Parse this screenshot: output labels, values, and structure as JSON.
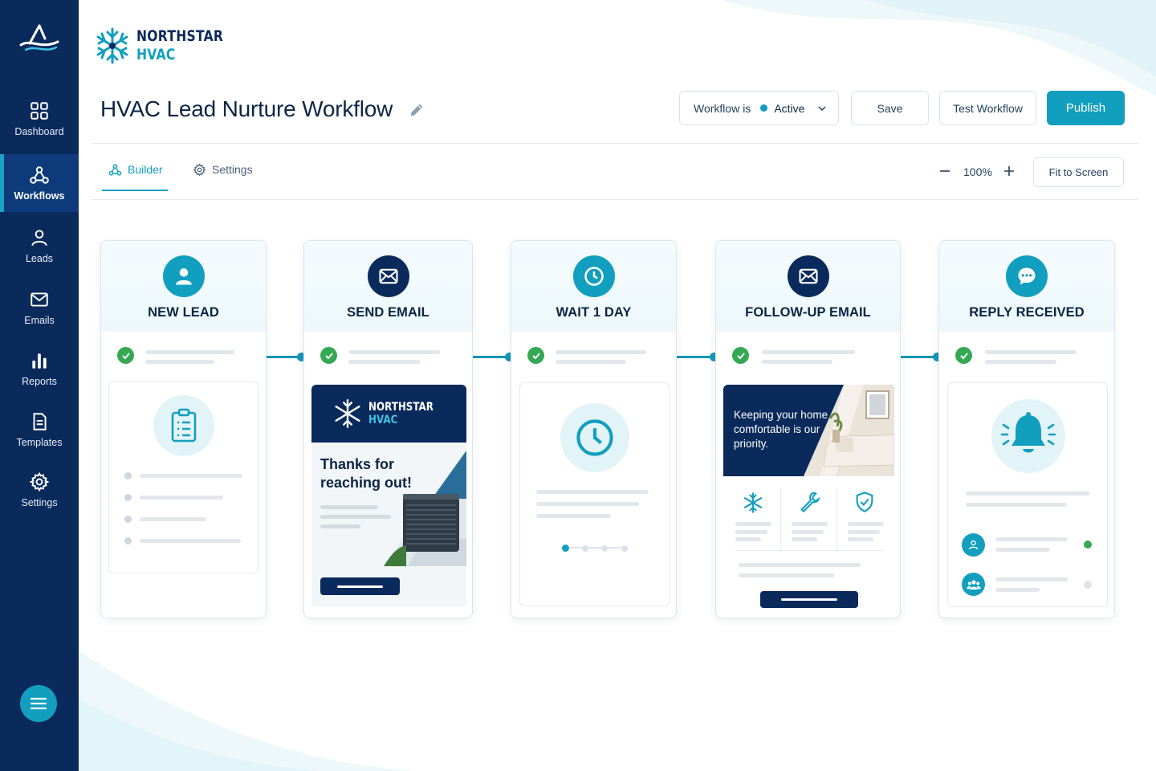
{
  "brand": {
    "line1": "NORTHSTAR",
    "line2": "HVAC"
  },
  "sidebar": {
    "items": [
      {
        "label": "Dashboard",
        "icon": "grid-icon"
      },
      {
        "label": "Workflows",
        "icon": "workflow-icon",
        "active": true
      },
      {
        "label": "Leads",
        "icon": "user-icon"
      },
      {
        "label": "Emails",
        "icon": "mail-icon"
      },
      {
        "label": "Reports",
        "icon": "bar-chart-icon"
      },
      {
        "label": "Templates",
        "icon": "document-icon"
      },
      {
        "label": "Settings",
        "icon": "gear-icon"
      }
    ]
  },
  "header": {
    "title": "HVAC Lead Nurture Workflow",
    "status_label": "Workflow is",
    "status_value": "Active",
    "save_label": "Save",
    "test_label": "Test Workflow",
    "publish_label": "Publish"
  },
  "tabs": [
    {
      "label": "Builder",
      "active": true
    },
    {
      "label": "Settings",
      "active": false
    }
  ],
  "zoom": {
    "value": "100%",
    "fit_label": "Fit to Screen"
  },
  "steps": [
    {
      "title": "NEW LEAD",
      "icon": "user-icon",
      "icon_bg": "#129fbf",
      "status": "complete"
    },
    {
      "title": "SEND EMAIL",
      "icon": "mail-icon",
      "icon_bg": "#0a2a5c",
      "status": "complete",
      "preview": {
        "brand1": "NORTHSTAR",
        "brand2": "HVAC",
        "heading": "Thanks for reaching out!"
      }
    },
    {
      "title": "WAIT 1 DAY",
      "icon": "clock-icon",
      "icon_bg": "#129fbf",
      "status": "complete"
    },
    {
      "title": "FOLLOW-UP EMAIL",
      "icon": "mail-icon",
      "icon_bg": "#0a2a5c",
      "status": "complete",
      "preview": {
        "hero_text": "Keeping your home comfortable is our priority."
      }
    },
    {
      "title": "REPLY RECEIVED",
      "icon": "chat-icon",
      "icon_bg": "#129fbf",
      "status": "complete"
    }
  ],
  "colors": {
    "navy": "#0a2a5c",
    "teal": "#129fbf",
    "success": "#34a853"
  }
}
